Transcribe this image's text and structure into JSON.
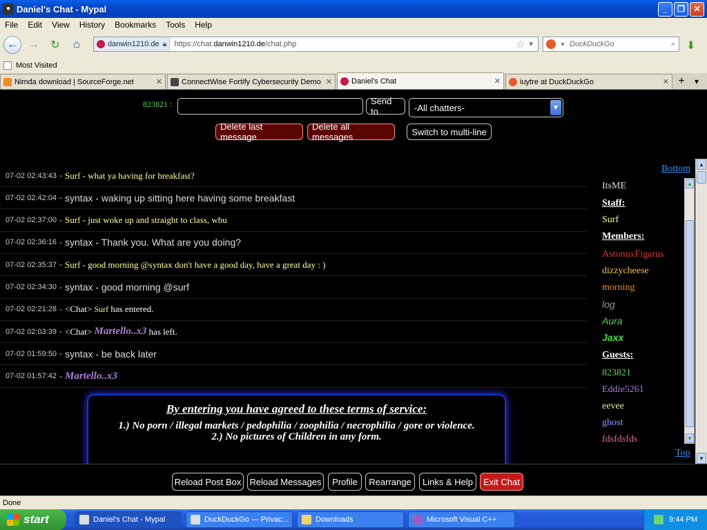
{
  "window": {
    "title": "Daniel's Chat - Mypal"
  },
  "menu": [
    "File",
    "Edit",
    "View",
    "History",
    "Bookmarks",
    "Tools",
    "Help"
  ],
  "nav": {
    "site": "danwin1210.de",
    "url_prefix": "https://chat.",
    "url_domain": "danwin1210.de",
    "url_path": "/chat.php",
    "search_placeholder": "DuckDuckGo"
  },
  "bookmarks": {
    "most_visited": "Most Visited"
  },
  "tabs": [
    {
      "label": "Nimda download | SourceForge.net",
      "icon_color": "#f28c28"
    },
    {
      "label": "ConnectWise Fortify Cybersecurity Demo",
      "icon_color": "#444444"
    },
    {
      "label": "Daniel's Chat",
      "icon_color": "#c51a4a"
    },
    {
      "label": "iuytre at DuckDuckGo",
      "icon_color": "#e65a2a"
    }
  ],
  "post": {
    "nickname": "823821 :",
    "send_label": "Send to",
    "chatters_select": "-All chatters-",
    "delete_last": "Delete last message",
    "delete_all": "Delete all messages",
    "multiline": "Switch to multi-line"
  },
  "messages": [
    {
      "time": "07-02 02:43:43",
      "kind": "surf",
      "name": "Surf",
      "text": " - what ya having for breakfast?"
    },
    {
      "time": "07-02 02:42:04",
      "kind": "syntax",
      "name": "syntax",
      "text": " - waking up sitting here having some breakfast"
    },
    {
      "time": "07-02 02:37:00",
      "kind": "surf",
      "name": "Surf",
      "text": " - just woke up and straight to class, wbu"
    },
    {
      "time": "07-02 02:36:16",
      "kind": "syntax",
      "name": "syntax",
      "text": " - Thank you. What are you doing?"
    },
    {
      "time": "07-02 02:35:37",
      "kind": "surf",
      "name": "Surf",
      "text": " - good morning @syntax don't have a good day, have a great day : )"
    },
    {
      "time": "07-02 02:34:30",
      "kind": "syntax",
      "name": "syntax",
      "text": " - good morning @surf"
    },
    {
      "time": "07-02 02:21:28",
      "kind": "sys",
      "prefix": "<Chat> ",
      "name": "Surf",
      "name_class": "name-surf",
      "text": " has entered."
    },
    {
      "time": "07-02 02:03:39",
      "kind": "sys",
      "prefix": "<Chat> ",
      "name": "Martello..x3",
      "name_class": "name-mart",
      "text": " has left."
    },
    {
      "time": "07-02 01:59:50",
      "kind": "syntax",
      "name": "syntax",
      "text": " - be back later"
    },
    {
      "time": "07-02 01:57:42",
      "kind": "mart",
      "name": "Martello..x3",
      "text": ""
    }
  ],
  "rules": {
    "heading": "By entering you have agreed to these terms of service:",
    "items": [
      "1.) No porn / illegal markets / pedophilia / zoophilia / necrophilia / gore or violence.",
      "2.) No pictures of Children in any form."
    ]
  },
  "userlist": {
    "bottom_link": "Bottom",
    "top_link": "Top",
    "entries": [
      {
        "text": "ItsME",
        "type": "user",
        "color": "#dddddd"
      },
      {
        "text": "Staff:",
        "type": "header"
      },
      {
        "text": "Surf",
        "type": "user",
        "color": "#ffff99"
      },
      {
        "text": "Members:",
        "type": "header"
      },
      {
        "text": "AstonuxFigarus",
        "type": "user",
        "color": "#d43a3a"
      },
      {
        "text": "dizzycheese",
        "type": "user",
        "color": "#f0c060"
      },
      {
        "text": "morning",
        "type": "user",
        "color": "#f08a30"
      },
      {
        "text": "log",
        "type": "user",
        "color": "#999999",
        "style": "italic"
      },
      {
        "text": "Aura",
        "type": "user",
        "color": "#5fd35f",
        "style": "italic"
      },
      {
        "text": "Jaxx",
        "type": "user",
        "color": "#3fe23f",
        "style": "bolditalic"
      },
      {
        "text": "Guests:",
        "type": "header"
      },
      {
        "text": "823821",
        "type": "user",
        "color": "#5fd35f"
      },
      {
        "text": "Eddie5261",
        "type": "user",
        "color": "#b27cd6"
      },
      {
        "text": "eevee",
        "type": "user",
        "color": "#e0f0a0"
      },
      {
        "text": "ghost",
        "type": "user",
        "color": "#8ba6ff"
      },
      {
        "text": "fdsfdsfds",
        "type": "user",
        "color": "#e07090"
      }
    ]
  },
  "bottom_buttons": [
    "Reload Post Box",
    "Reload Messages",
    "Profile",
    "Rearrange",
    "Links & Help",
    "Exit Chat"
  ],
  "status": "Done",
  "taskbar": {
    "start": "start",
    "tasks": [
      "Daniel's Chat - Mypal",
      "DuckDuckGo — Privac...",
      "Downloads",
      "Microsoft Visual C++"
    ],
    "clock": "9:44 PM"
  }
}
